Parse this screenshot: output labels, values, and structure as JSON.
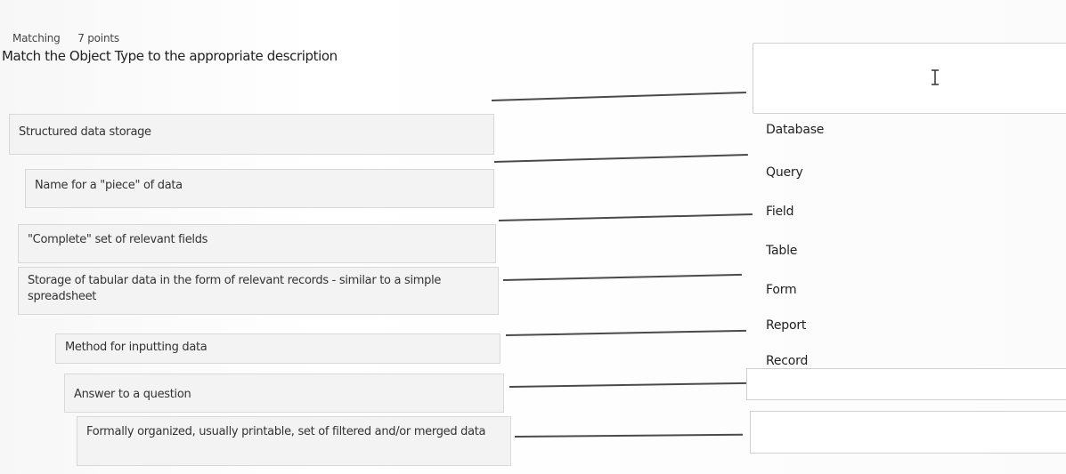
{
  "header": {
    "type": "Matching",
    "points": "7 points"
  },
  "question": "Match the Object Type to the appropriate description",
  "descriptions": [
    {
      "label": "Structured data storage"
    },
    {
      "label": "Name for a \"piece\" of data"
    },
    {
      "label": "\"Complete\" set of relevant fields"
    },
    {
      "label": "Storage of tabular data in the form of relevant records - similar to a simple spreadsheet"
    },
    {
      "label": "Method for inputting data"
    },
    {
      "label": "Answer to a question"
    },
    {
      "label": "Formally organized, usually printable, set of filtered and/or merged data"
    }
  ],
  "options": [
    {
      "label": "Database"
    },
    {
      "label": "Query"
    },
    {
      "label": "Field"
    },
    {
      "label": "Table"
    },
    {
      "label": "Form"
    },
    {
      "label": "Report"
    },
    {
      "label": "Record"
    }
  ],
  "icons": {
    "cursor": "text-cursor-icon"
  }
}
